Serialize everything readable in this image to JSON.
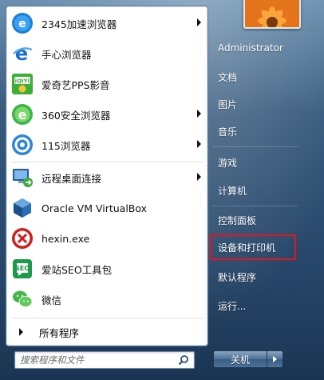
{
  "programs": [
    {
      "label": "2345加速浏览器",
      "icon": "browser-2345-icon",
      "submenu": true
    },
    {
      "label": "手心浏览器",
      "icon": "shouxin-browser-icon",
      "submenu": false
    },
    {
      "label": "爱奇艺PPS影音",
      "icon": "iqiyi-pps-icon",
      "submenu": false
    },
    {
      "label": "360安全浏览器",
      "icon": "browser-360-icon",
      "submenu": true
    },
    {
      "label": "115浏览器",
      "icon": "browser-115-icon",
      "submenu": true
    },
    {
      "label": "远程桌面连接",
      "icon": "remote-desktop-icon",
      "submenu": true
    },
    {
      "label": "Oracle VM VirtualBox",
      "icon": "virtualbox-icon",
      "submenu": false
    },
    {
      "label": "hexin.exe",
      "icon": "hexin-icon",
      "submenu": false
    },
    {
      "label": "爱站SEO工具包",
      "icon": "aizhan-seo-icon",
      "submenu": false
    },
    {
      "label": "微信",
      "icon": "wechat-icon",
      "submenu": false
    }
  ],
  "all_programs_label": "所有程序",
  "search": {
    "placeholder": "搜索程序和文件"
  },
  "right": {
    "user": "Administrator",
    "items": [
      "文档",
      "图片",
      "音乐",
      "游戏",
      "计算机",
      "控制面板",
      "设备和打印机",
      "默认程序",
      "运行..."
    ]
  },
  "shutdown_label": "关机",
  "colors": {
    "highlight_border": "#e8141c",
    "menu_bg": "#27476a"
  }
}
